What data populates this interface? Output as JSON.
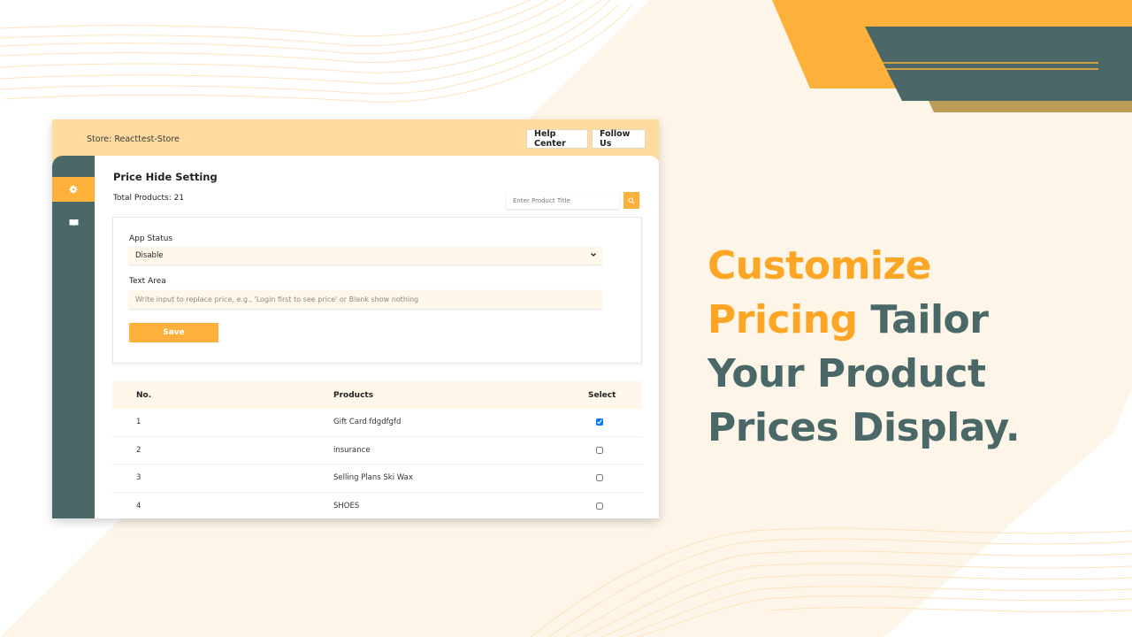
{
  "colors": {
    "accent": "#fdb03a",
    "headline_accent": "#fda626",
    "teal": "#4b6869",
    "topbar": "#ffdb9f",
    "cream": "#fdf5e8"
  },
  "header": {
    "store_label": "Store: Reacttest-Store",
    "help_center": "Help Center",
    "follow_us": "Follow Us"
  },
  "sidebar": {
    "items": [
      {
        "icon": "gear-icon",
        "active": true
      },
      {
        "icon": "book-icon",
        "active": false
      }
    ]
  },
  "main": {
    "title": "Price Hide Setting",
    "total_products": "Total Products: 21",
    "search_placeholder": "Enter Product Title",
    "app_status_label": "App Status",
    "app_status_value": "Disable",
    "text_area_label": "Text Area",
    "text_area_placeholder": "Write input to replace price, e.g., 'Login first to see price' or Blank show nothing",
    "save_label": "Save"
  },
  "table": {
    "headers": {
      "no": "No.",
      "products": "Products",
      "select": "Select"
    },
    "rows": [
      {
        "no": "1",
        "product": "Gift Card fdgdfgfd",
        "selected": true
      },
      {
        "no": "2",
        "product": "insurance",
        "selected": false
      },
      {
        "no": "3",
        "product": "Selling Plans Ski Wax",
        "selected": false
      },
      {
        "no": "4",
        "product": "SHOES",
        "selected": false
      }
    ]
  },
  "promo": {
    "line1_accent": "Customize",
    "line2_accent": "Pricing",
    "line2_rest": " Tailor",
    "line3": "Your Product",
    "line4": "Prices Display."
  }
}
